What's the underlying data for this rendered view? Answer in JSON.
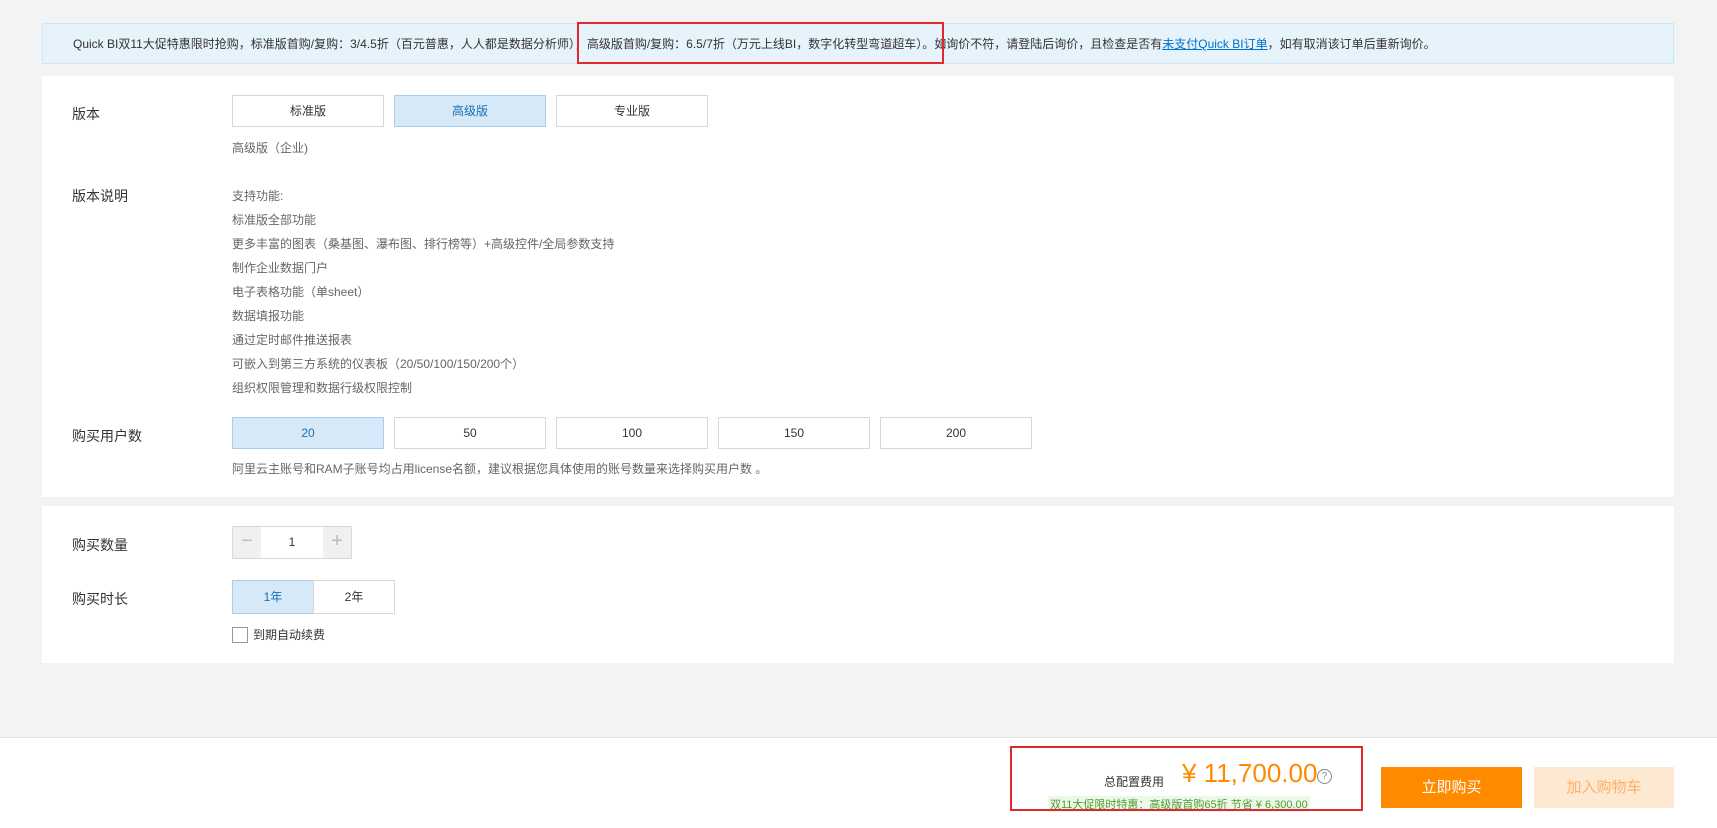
{
  "notice": {
    "text_before": "Quick BI双11大促特惠限时抢购，标准版首购/复购：3/4.5折（百元普惠，人人都是数据分析师）",
    "text_highlight": "，高级版首购/复购：6.5/7折（万元上线BI，数字化转型弯道超车）。",
    "text_after": "如询价不符，请登陆后询价，且检查是否有",
    "link": "未支付Quick BI订单",
    "text_end": "，如有取消该订单后重新询价。"
  },
  "version": {
    "label": "版本",
    "options": [
      "标准版",
      "高级版",
      "专业版"
    ],
    "selected_index": 1,
    "selected_desc": "高级版（企业)"
  },
  "description": {
    "label": "版本说明",
    "lines": [
      "支持功能:",
      "标准版全部功能",
      "更多丰富的图表（桑基图、瀑布图、排行榜等）+高级控件/全局参数支持",
      "制作企业数据门户",
      "电子表格功能（单sheet）",
      "数据填报功能",
      "通过定时邮件推送报表",
      "可嵌入到第三方系统的仪表板（20/50/100/150/200个）",
      "组织权限管理和数据行级权限控制"
    ]
  },
  "users": {
    "label": "购买用户数",
    "options": [
      "20",
      "50",
      "100",
      "150",
      "200"
    ],
    "selected_index": 0,
    "hint": "阿里云主账号和RAM子账号均占用license名额，建议根据您具体使用的账号数量来选择购买用户数 。"
  },
  "quantity": {
    "label": "购买数量",
    "value": "1",
    "minus": "−",
    "plus": "+"
  },
  "duration": {
    "label": "购买时长",
    "options": [
      "1年",
      "2年"
    ],
    "selected_index": 0,
    "auto_renew_label": "到期自动续费"
  },
  "footer": {
    "total_label": "总配置费用",
    "total_price": "¥ 11,700.00",
    "help": "?",
    "promo": "双11大促限时特惠：高级版首购65折  节省  ¥ 6,300.00",
    "buy_now": "立即购买",
    "add_cart": "加入购物车"
  },
  "colors": {
    "accent": "#ff8a00",
    "selected_bg": "#d6e9f8",
    "highlight_box": "#e0282e",
    "link": "#0070cc"
  }
}
